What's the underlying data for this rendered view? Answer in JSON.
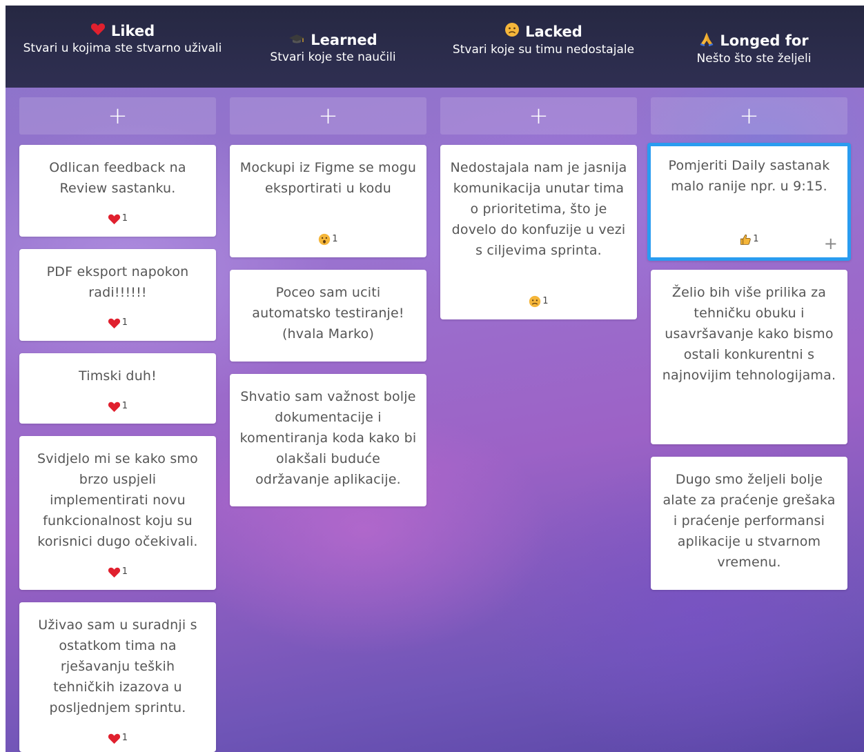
{
  "columns": [
    {
      "title": "Liked",
      "subtitle": "Stvari u kojima ste stvarno uživali",
      "icon": "heart-icon",
      "add_label": "+"
    },
    {
      "title": "Learned",
      "subtitle": "Stvari koje ste naučili",
      "icon": "graduation-cap-icon",
      "add_label": "+"
    },
    {
      "title": "Lacked",
      "subtitle": "Stvari koje su timu nedostajale",
      "icon": "sad-face-icon",
      "add_label": "+"
    },
    {
      "title": "Longed for",
      "subtitle": "Nešto što ste željeli",
      "icon": "praying-hands-icon",
      "add_label": "+"
    }
  ],
  "cards": {
    "liked": [
      {
        "text": "Odlican feedback na Review sastanku.",
        "reaction": "heart-icon",
        "count": "1"
      },
      {
        "text": "PDF eksport napokon radi!!!!!!",
        "reaction": "heart-icon",
        "count": "1"
      },
      {
        "text": "Timski duh!",
        "reaction": "heart-icon",
        "count": "1"
      },
      {
        "text": "Svidjelo mi se kako smo brzo uspjeli implementirati novu funkcionalnost koju su korisnici dugo očekivali.",
        "reaction": "heart-icon",
        "count": "1"
      },
      {
        "text": "Uživao sam u suradnji s ostatkom tima na rješavanju teških tehničkih izazova u posljednjem sprintu.",
        "reaction": "heart-icon",
        "count": "1"
      }
    ],
    "learned": [
      {
        "text": "Mockupi iz Figme se mogu eksportirati u kodu",
        "reaction": "surprised-face-icon",
        "count": "1"
      },
      {
        "text": "Poceo sam uciti automatsko testiranje! (hvala Marko)"
      },
      {
        "text": "Shvatio sam važnost bolje dokumentacije i komentiranja koda kako bi olakšali buduće održavanje aplikacije."
      }
    ],
    "lacked": [
      {
        "text": "Nedostajala nam je jasnija komunikacija unutar tima o prioritetima, što je dovelo do konfuzije u vezi s ciljevima sprinta.",
        "reaction": "sad-face-icon",
        "count": "1"
      }
    ],
    "longed": [
      {
        "text": "Pomjeriti Daily sastanak malo ranije npr. u 9:15.",
        "reaction": "thumbs-up-icon",
        "count": "1",
        "add_reaction": "+"
      },
      {
        "text": "Želio bih više prilika za tehničku obuku i usavršavanje kako bismo ostali konkurentni s najnovijim tehnologijama."
      },
      {
        "text": "Dugo smo željeli bolje alate za praćenje grešaka i praćenje performansi aplikacije u stvarnom vremenu."
      }
    ]
  },
  "colors": {
    "header": "#262842",
    "selected_border": "#2a9cf0",
    "heart": "#e0202e"
  }
}
